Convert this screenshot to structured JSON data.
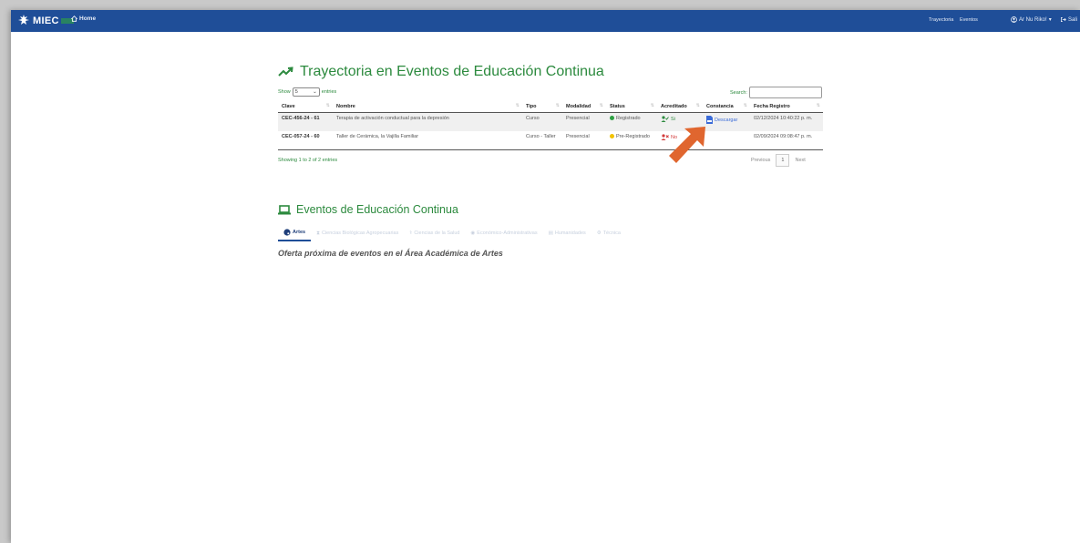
{
  "navbar": {
    "brand": "MIEC",
    "home": "Home",
    "links": [
      "Trayectoria",
      "Eventos"
    ],
    "user": "Ar Nu Riko!",
    "logout": "Sali"
  },
  "trayectoria": {
    "title": "Trayectoria en Eventos de Educación Continua",
    "show_label": "Show",
    "entries_value": "5",
    "entries_label": "entries",
    "search_label": "Search:",
    "columns": [
      "Clave",
      "Nombre",
      "Tipo",
      "Modalidad",
      "Status",
      "Acreditado",
      "Constancia",
      "Fecha Registro"
    ],
    "rows": [
      {
        "clave": "CEC-456-24 - 61",
        "nombre": "Terapia de activación conductual para la depresión",
        "tipo": "Curso",
        "modalidad": "Presencial",
        "status": "Registrado",
        "status_color": "#2ea043",
        "acreditado": "Si",
        "acreditado_color": "#2c8a3e",
        "constancia": "Descargar",
        "fecha": "02/12/2024 10:40:22 p. m."
      },
      {
        "clave": "CEC-057-24 - 60",
        "nombre": "Taller de Cerámica, la Vajilla Familiar",
        "tipo": "Curso - Taller",
        "modalidad": "Presencial",
        "status": "Pre-Registrado",
        "status_color": "#f2c200",
        "acreditado": "No",
        "acreditado_color": "#d23b3b",
        "constancia": "",
        "fecha": "02/09/2024 09:08:47 p. m."
      }
    ],
    "info": "Showing 1 to 2 of 2 entries",
    "previous": "Previous",
    "page": "1",
    "next": "Next"
  },
  "eventos": {
    "title": "Eventos de Educación Continua",
    "tabs": [
      {
        "label": "Artes",
        "icon": "palette-icon",
        "active": true
      },
      {
        "label": "Ciencias Biológicas Agropecuarias",
        "icon": "dna-icon",
        "active": false
      },
      {
        "label": "Ciencias de la Salud",
        "icon": "caduceus-icon",
        "active": false
      },
      {
        "label": "Económico-Administrativas",
        "icon": "coins-icon",
        "active": false
      },
      {
        "label": "Humanidades",
        "icon": "books-icon",
        "active": false
      },
      {
        "label": "Técnica",
        "icon": "gear-icon",
        "active": false
      }
    ],
    "oferta": "Oferta próxima de eventos en el Área Académica de Artes"
  },
  "colors": {
    "navbar": "#1f4e98",
    "accent_green": "#2c8a3e",
    "arrow": "#e0662f",
    "link": "#3a6bd8"
  }
}
